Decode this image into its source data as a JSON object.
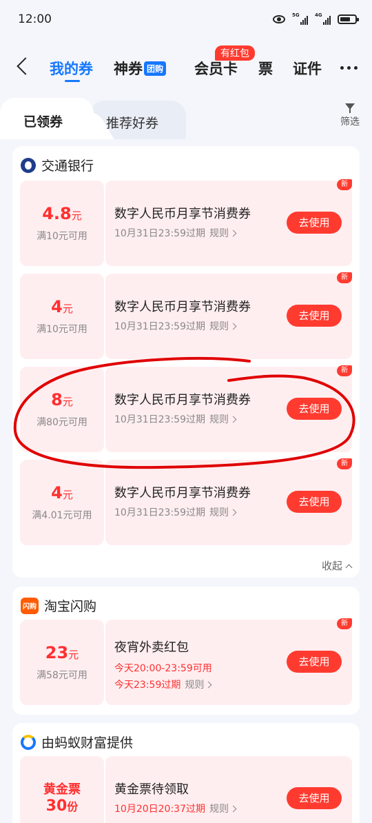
{
  "status_bar": {
    "time": "12:00",
    "network1": "5G",
    "network2": "4G"
  },
  "nav": {
    "tabs": [
      "我的券",
      "神券",
      "会员卡",
      "票",
      "证件"
    ],
    "group_badge": "团购",
    "hongbao_badge": "有红包"
  },
  "segment": {
    "tabs": [
      "已领券",
      "推荐好券"
    ],
    "filter_label": "筛选"
  },
  "groups": [
    {
      "title": "交通银行",
      "logo": "bocom-logo-icon",
      "collapse_label": "收起",
      "coupons": [
        {
          "amount": "4.8",
          "unit": "元",
          "condition": "满10元可用",
          "title": "数字人民币月享节消费券",
          "expiry": "10月31日23:59过期",
          "rule": "规则",
          "button": "去使用",
          "badge": "新"
        },
        {
          "amount": "4",
          "unit": "元",
          "condition": "满10元可用",
          "title": "数字人民币月享节消费券",
          "expiry": "10月31日23:59过期",
          "rule": "规则",
          "button": "去使用",
          "badge": "新"
        },
        {
          "amount": "8",
          "unit": "元",
          "condition": "满80元可用",
          "title": "数字人民币月享节消费券",
          "expiry": "10月31日23:59过期",
          "rule": "规则",
          "button": "去使用",
          "badge": "新"
        },
        {
          "amount": "4",
          "unit": "元",
          "condition": "满4.01元可用",
          "title": "数字人民币月享节消费券",
          "expiry": "10月31日23:59过期",
          "rule": "规则",
          "button": "去使用",
          "badge": "新"
        }
      ]
    },
    {
      "title": "淘宝闪购",
      "logo_text": "闪购",
      "coupons": [
        {
          "amount": "23",
          "unit": "元",
          "condition": "满58元可用",
          "title": "夜宵外卖红包",
          "time_range": "今天20:00-23:59可用",
          "expiry": "今天23:59过期",
          "rule": "规则",
          "button": "去使用",
          "badge": "新"
        }
      ]
    },
    {
      "title": "由蚂蚁财富提供",
      "logo": "ant-fortune-logo-icon",
      "coupons": [
        {
          "top": "黄金票",
          "amount": "30",
          "unit": "份",
          "title": "黄金票待领取",
          "expiry": "10月20日20:37过期",
          "rule": "规则",
          "button": "去使用"
        }
      ]
    }
  ],
  "annotation_color": "#e00000"
}
